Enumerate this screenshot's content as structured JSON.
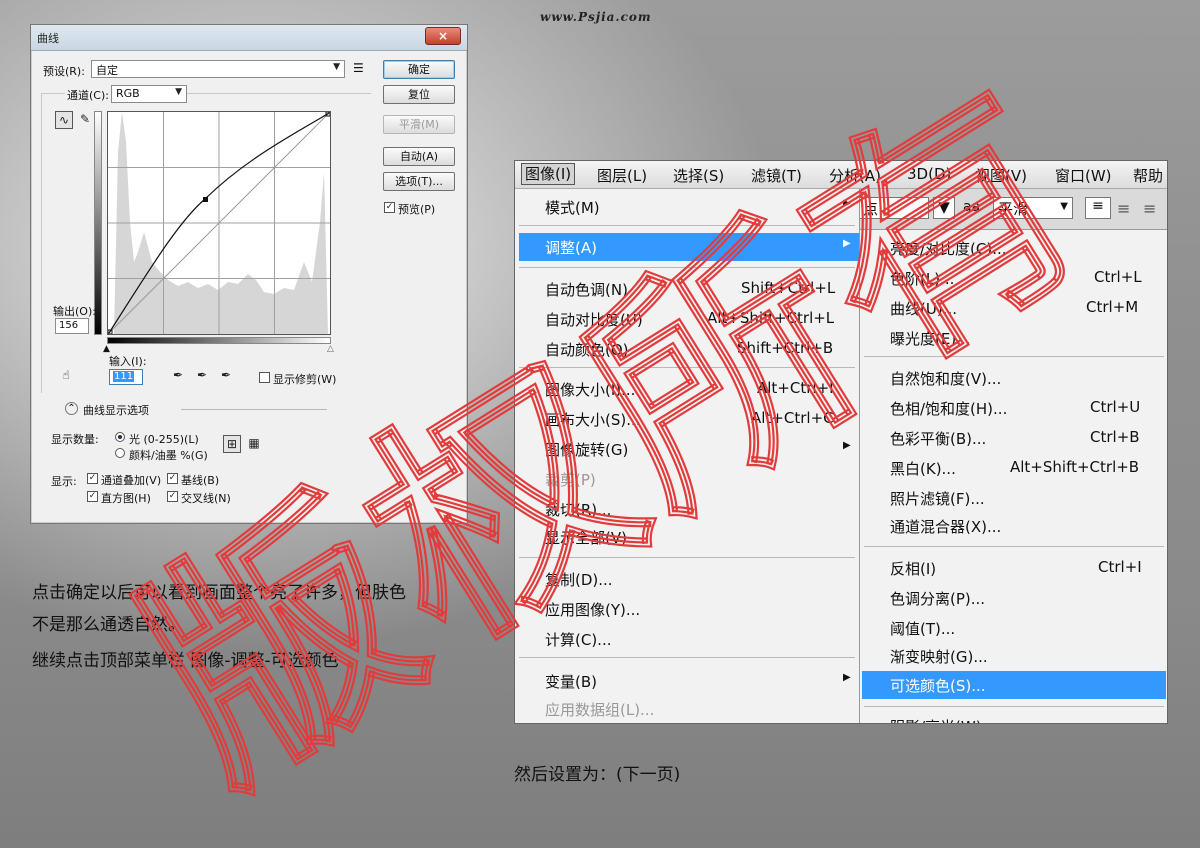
{
  "site_watermark": "www.Psjia.com",
  "curves_dialog": {
    "title": "曲线",
    "close": "×",
    "preset_label": "预设(R):",
    "preset_value": "自定",
    "channel_label": "通道(C):",
    "channel_value": "RGB",
    "buttons": {
      "ok": "确定",
      "reset": "复位",
      "smooth": "平滑(M)",
      "auto": "自动(A)",
      "options": "选项(T)..."
    },
    "preview_label": "预览(P)",
    "output_label": "输出(O):",
    "output_value": "156",
    "input_label": "输入(I):",
    "input_value": "111",
    "show_clipping_label": "显示修剪(W)",
    "display_options_label": "曲线显示选项",
    "show_amount_label": "显示数量:",
    "light_label": "光 (0-255)(L)",
    "pigment_label": "颜料/油墨 %(G)",
    "show_label": "显示:",
    "channel_overlay_label": "通道叠加(V)",
    "baseline_label": "基线(B)",
    "histogram_label": "直方图(H)",
    "intersection_label": "交叉线(N)"
  },
  "menu_shot": {
    "menubar": [
      "图像(I)",
      "图层(L)",
      "选择(S)",
      "滤镜(T)",
      "分析(A)",
      "3D(D)",
      "视图(V)",
      "窗口(W)",
      "帮助"
    ],
    "toolbar": {
      "field1": "点",
      "aa": "aa",
      "antialias": "平滑"
    },
    "image_menu": [
      {
        "label": "模式(M)",
        "shortcut": "",
        "arrow": "▶"
      },
      {
        "label": "调整(A)",
        "shortcut": "",
        "arrow": "▶"
      },
      {
        "label": "自动色调(N)",
        "shortcut": "Shift+Ctrl+L",
        "arrow": ""
      },
      {
        "label": "自动对比度(U)",
        "shortcut": "Alt+Shift+Ctrl+L",
        "arrow": ""
      },
      {
        "label": "自动颜色(O)",
        "shortcut": "Shift+Ctrl+B",
        "arrow": ""
      },
      {
        "label": "图像大小(I)...",
        "shortcut": "Alt+Ctrl+I",
        "arrow": ""
      },
      {
        "label": "画布大小(S)...",
        "shortcut": "Alt+Ctrl+C",
        "arrow": ""
      },
      {
        "label": "图像旋转(G)",
        "shortcut": "",
        "arrow": "▶"
      },
      {
        "label": "裁剪(P)",
        "shortcut": "",
        "arrow": ""
      },
      {
        "label": "裁切(R)...",
        "shortcut": "",
        "arrow": ""
      },
      {
        "label": "显示全部(V)",
        "shortcut": "",
        "arrow": ""
      },
      {
        "label": "复制(D)...",
        "shortcut": "",
        "arrow": ""
      },
      {
        "label": "应用图像(Y)...",
        "shortcut": "",
        "arrow": ""
      },
      {
        "label": "计算(C)...",
        "shortcut": "",
        "arrow": ""
      },
      {
        "label": "变量(B)",
        "shortcut": "",
        "arrow": "▶"
      },
      {
        "label": "应用数据组(L)...",
        "shortcut": "",
        "arrow": ""
      }
    ],
    "adjust_submenu": [
      {
        "label": "亮度/对比度(C)...",
        "shortcut": ""
      },
      {
        "label": "色阶(L)...",
        "shortcut": "Ctrl+L"
      },
      {
        "label": "曲线(U)...",
        "shortcut": "Ctrl+M"
      },
      {
        "label": "曝光度(E)...",
        "shortcut": ""
      },
      {
        "label": "自然饱和度(V)...",
        "shortcut": ""
      },
      {
        "label": "色相/饱和度(H)...",
        "shortcut": "Ctrl+U"
      },
      {
        "label": "色彩平衡(B)...",
        "shortcut": "Ctrl+B"
      },
      {
        "label": "黑白(K)...",
        "shortcut": "Alt+Shift+Ctrl+B"
      },
      {
        "label": "照片滤镜(F)...",
        "shortcut": ""
      },
      {
        "label": "通道混合器(X)...",
        "shortcut": ""
      },
      {
        "label": "反相(I)",
        "shortcut": "Ctrl+I"
      },
      {
        "label": "色调分离(P)...",
        "shortcut": ""
      },
      {
        "label": "阈值(T)...",
        "shortcut": ""
      },
      {
        "label": "渐变映射(G)...",
        "shortcut": ""
      },
      {
        "label": "可选颜色(S)...",
        "shortcut": ""
      },
      {
        "label": "阴影/高光(W)...",
        "shortcut": ""
      }
    ]
  },
  "captions": {
    "line1": "点击确定以后可以看到画面整个亮了许多，但肤色",
    "line2": "不是那么通透自然。",
    "line3": "继续点击顶部菜单栏 图像-调整-可选颜色",
    "next": "然后设置为：(下一页)"
  },
  "stamp_text": "版权所有",
  "colors": {
    "highlight": "#3399ff",
    "stamp": "#e23b3b"
  }
}
